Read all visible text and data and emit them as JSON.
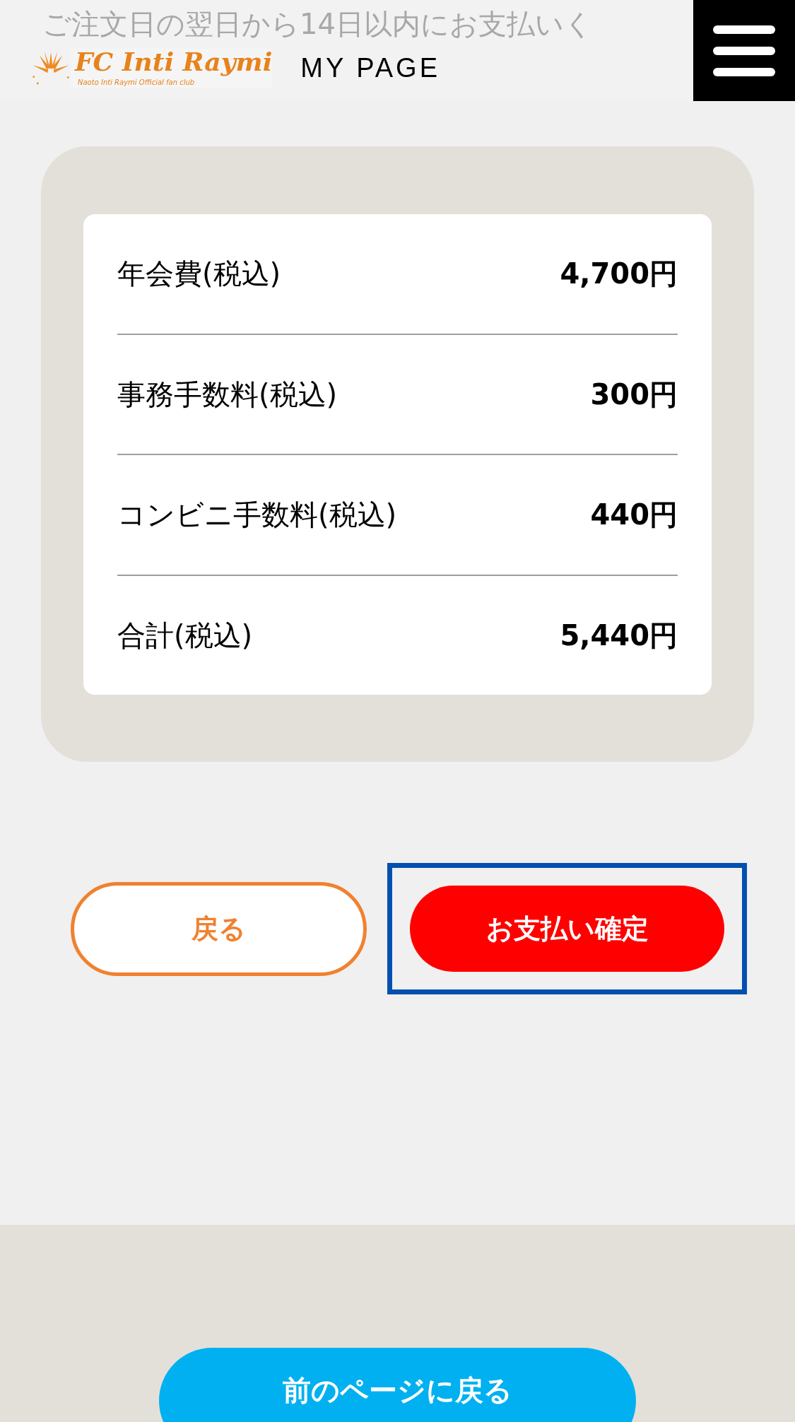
{
  "background_text": "ご注文日の翌日から14日以内にお支払いく",
  "header": {
    "logo": {
      "name": "FC Inti Raymi",
      "tagline": "Naoto Inti Raymi Official fan club"
    },
    "title": "MY PAGE"
  },
  "fees": [
    {
      "label": "年会費(税込)",
      "amount": "4,700円"
    },
    {
      "label": "事務手数料(税込)",
      "amount": "300円"
    },
    {
      "label": "コンビニ手数料(税込)",
      "amount": "440円"
    },
    {
      "label": "合計(税込)",
      "amount": "5,440円"
    }
  ],
  "buttons": [
    {
      "label": "戻る",
      "kind": "outline",
      "highlighted": false
    },
    {
      "label": "お支払い確定",
      "kind": "primary",
      "highlighted": true
    }
  ],
  "footer": {
    "back_link": "前のページに戻る"
  }
}
